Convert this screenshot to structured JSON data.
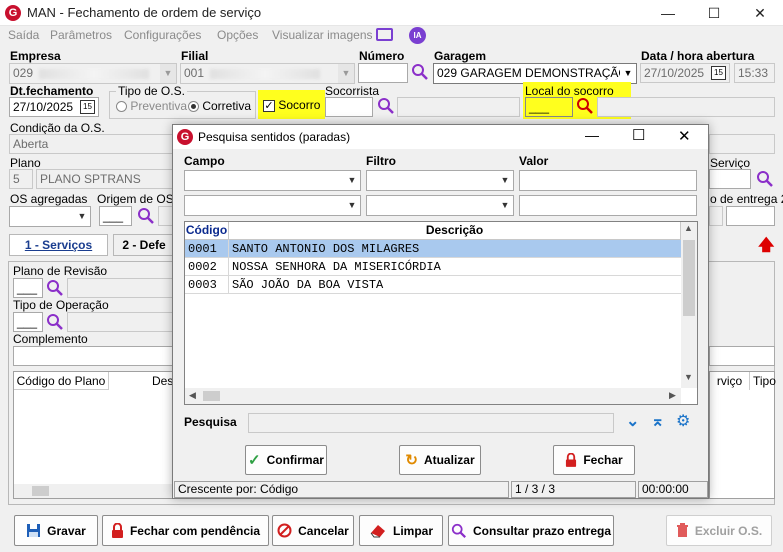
{
  "window": {
    "title": "MAN - Fechamento de ordem de serviço",
    "logo": "G"
  },
  "menu": [
    "Saída",
    "Parâmetros",
    "Configurações",
    "Opções",
    "Visualizar imagens"
  ],
  "form": {
    "empresa_label": "Empresa",
    "empresa_value": "029",
    "filial_label": "Filial",
    "filial_value": "001",
    "numero_label": "Número",
    "numero_value": "",
    "garagem_label": "Garagem",
    "garagem_value": "029 GARAGEM DEMONSTRAÇÃO",
    "data_abertura_label": "Data / hora abertura",
    "data_abertura_value": "27/10/2025",
    "hora_abertura_value": "15:33",
    "dt_fechamento_label": "Dt.fechamento",
    "dt_fechamento_value": "27/10/2025",
    "tipo_os_label": "Tipo de O.S.",
    "preventiva_label": "Preventiva",
    "corretiva_label": "Corretiva",
    "socorro_label": "Socorro",
    "socorrista_label": "Socorrista",
    "local_socorro_label": "Local do socorro",
    "condicao_label": "Condição da O.S.",
    "condicao_value": "Aberta",
    "plano_label": "Plano",
    "plano_code": "5",
    "plano_value": "PLANO SPTRANS",
    "servico_label": "Serviço",
    "os_agregadas_label": "OS agregadas",
    "origem_os_label": "Origem de OS",
    "prev_entrega_label": "o de entrega 2"
  },
  "tabs": {
    "servicos": "1 - Serviços",
    "defeitos": "2 - Defe"
  },
  "panel": {
    "plano_revisao_label": "Plano de Revisão",
    "tipo_operacao_label": "Tipo de Operação",
    "complemento_label": "Complemento",
    "col_codigo_plano": "Código do Plano",
    "col_des": "Des",
    "col_servico": "rviço",
    "col_tipo": "Tipo"
  },
  "dialog": {
    "title": "Pesquisa sentidos (paradas)",
    "campo_label": "Campo",
    "filtro_label": "Filtro",
    "valor_label": "Valor",
    "col_codigo": "Código",
    "col_descricao": "Descrição",
    "rows": [
      {
        "codigo": "0001",
        "descricao": "SANTO ANTONIO DOS MILAGRES"
      },
      {
        "codigo": "0002",
        "descricao": "NOSSA SENHORA DA MISERICÓRDIA"
      },
      {
        "codigo": "0003",
        "descricao": "SÃO JOÃO DA BOA VISTA"
      }
    ],
    "pesquisa_label": "Pesquisa",
    "confirmar": "Confirmar",
    "atualizar": "Atualizar",
    "fechar": "Fechar",
    "status_order": "Crescente por: Código",
    "status_count": "1 / 3 / 3",
    "status_time": "00:00:00"
  },
  "buttons": {
    "gravar": "Gravar",
    "fechar_pendencia": "Fechar com pendência",
    "cancelar": "Cancelar",
    "limpar": "Limpar",
    "consultar": "Consultar prazo entrega",
    "excluir": "Excluir O.S."
  },
  "colors": {
    "accent_red": "#c8102e",
    "highlight_yellow": "#ffff1e",
    "selection_blue": "#a9c9ee",
    "magnifier": "#8b2fc9"
  }
}
